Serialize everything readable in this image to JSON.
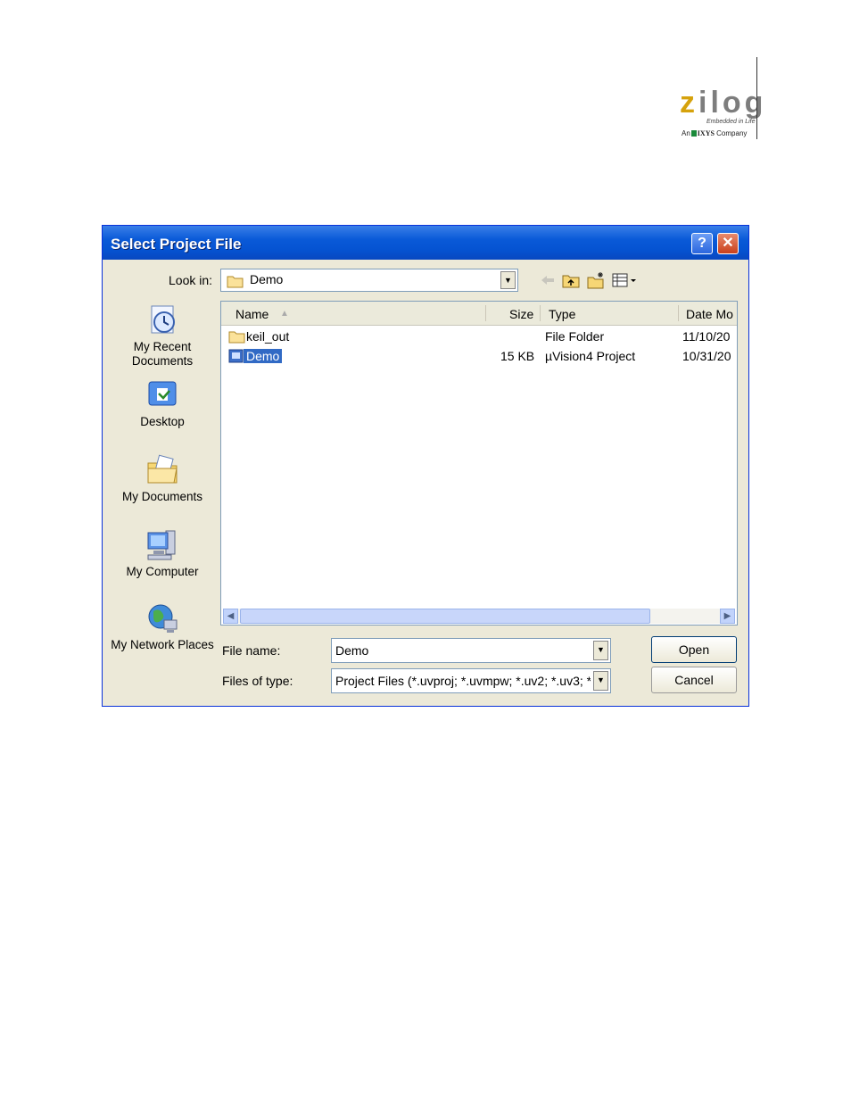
{
  "header": {
    "logo_word_z": "z",
    "logo_word_rest": "ilog",
    "logo_tagline": "Embedded in Life",
    "logo_company_prefix": "An",
    "logo_company_brand": "IXYS",
    "logo_company_suffix": "Company"
  },
  "dialog": {
    "title": "Select Project File",
    "help_label": "?",
    "close_label": "✕",
    "look_in_label": "Look in:",
    "look_in_value": "Demo",
    "places": [
      {
        "label": "My Recent Documents",
        "icon": "recent-documents-icon"
      },
      {
        "label": "Desktop",
        "icon": "desktop-icon"
      },
      {
        "label": "My Documents",
        "icon": "my-documents-icon"
      },
      {
        "label": "My Computer",
        "icon": "my-computer-icon"
      },
      {
        "label": "My Network Places",
        "icon": "network-places-icon"
      }
    ],
    "columns": {
      "name": "Name",
      "size": "Size",
      "type": "Type",
      "date": "Date Mo"
    },
    "files": [
      {
        "name": "keil_out",
        "size": "",
        "type": "File Folder",
        "date": "11/10/20"
      },
      {
        "name": "Demo",
        "size": "15 KB",
        "type": "µVision4 Project",
        "date": "10/31/20"
      }
    ],
    "file_name_label": "File name:",
    "file_name_value": "Demo",
    "files_of_type_label": "Files of type:",
    "files_of_type_value": "Project Files (*.uvproj; *.uvmpw; *.uv2; *.uv3; *.",
    "open_label": "Open",
    "cancel_label": "Cancel"
  },
  "colors": {
    "title_bar": "#0553d2",
    "selection": "#316ac5",
    "dialog_bg": "#ece9d8"
  }
}
